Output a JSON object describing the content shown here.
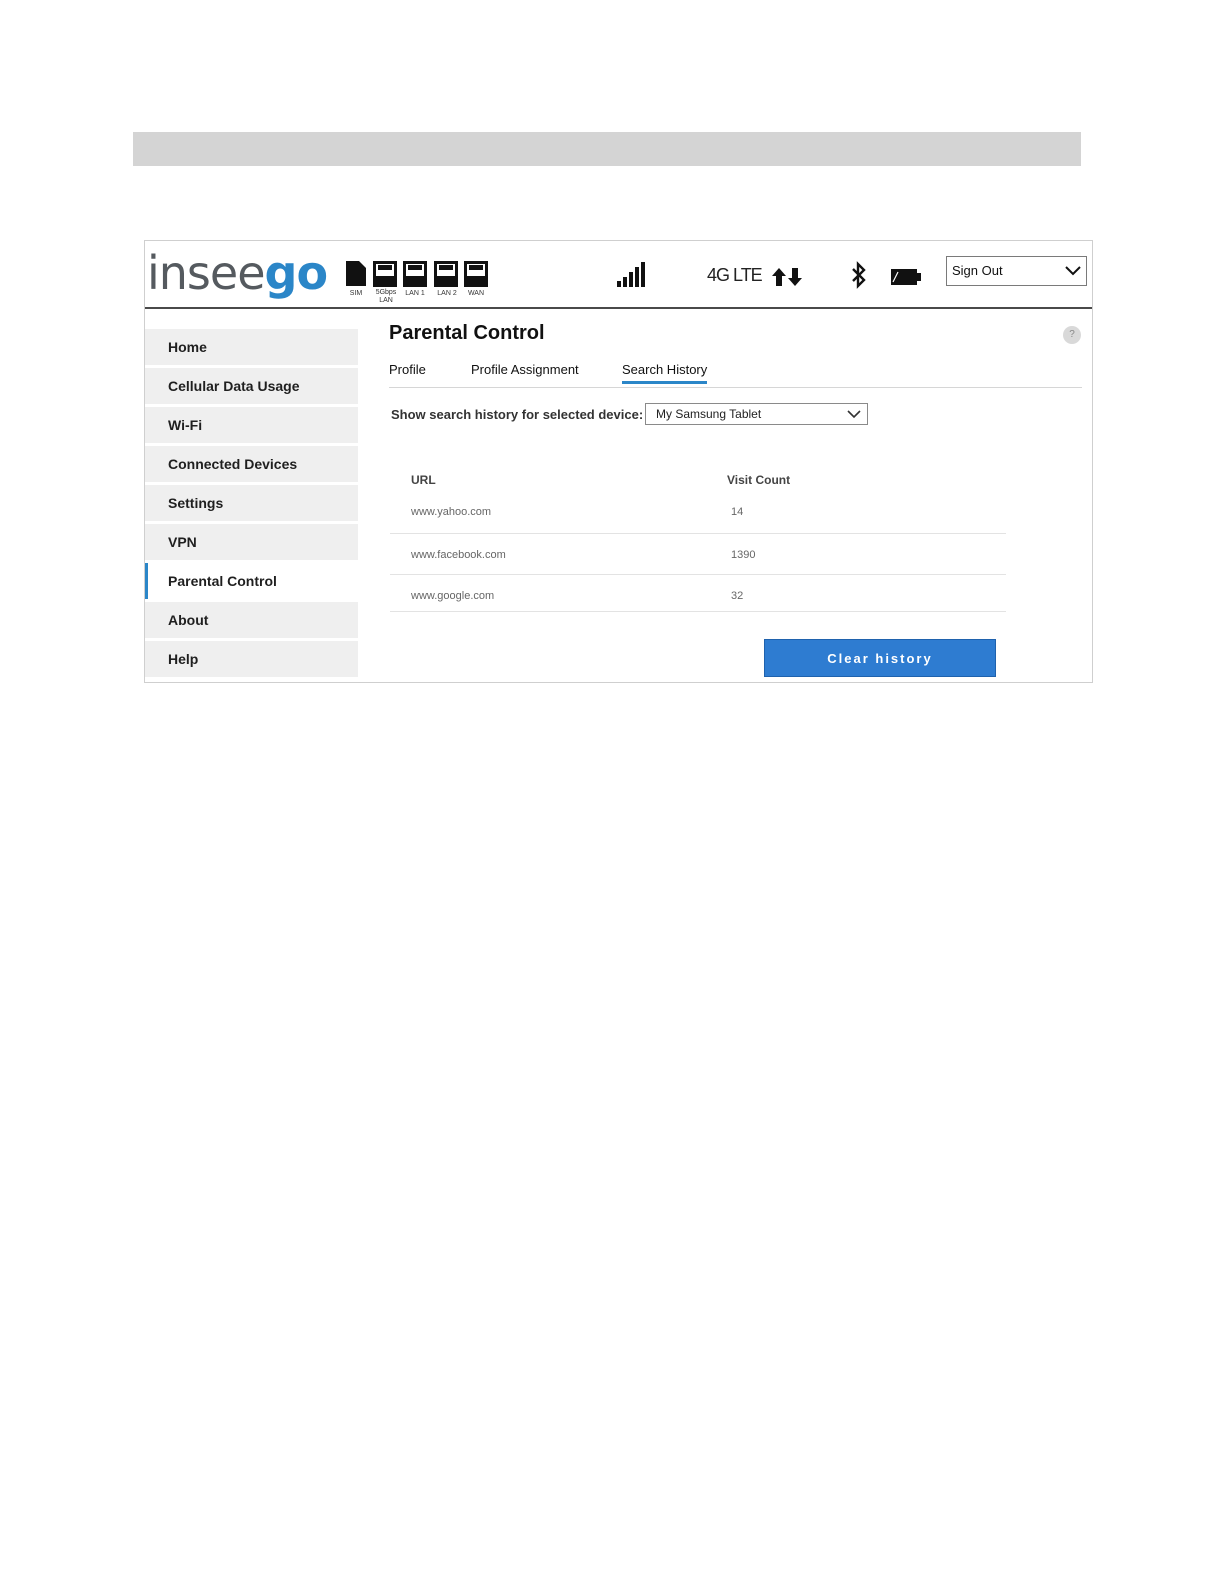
{
  "brand": {
    "logo_part1": "insee",
    "logo_part2": "go"
  },
  "header": {
    "ports": [
      {
        "label": "SIM"
      },
      {
        "label": "5Gbps LAN"
      },
      {
        "label": "LAN 1"
      },
      {
        "label": "LAN 2"
      },
      {
        "label": "WAN"
      }
    ],
    "network_type": "4G LTE",
    "icons": [
      "sim-card-icon",
      "ethernet-port-icon",
      "signal-bars-icon",
      "data-arrows-icon",
      "bluetooth-icon",
      "battery-icon"
    ],
    "signout_label": "Sign Out"
  },
  "sidebar": {
    "items": [
      {
        "label": "Home"
      },
      {
        "label": "Cellular Data Usage"
      },
      {
        "label": "Wi-Fi"
      },
      {
        "label": "Connected Devices"
      },
      {
        "label": "Settings"
      },
      {
        "label": "VPN"
      },
      {
        "label": "Parental Control",
        "active": true
      },
      {
        "label": "About"
      },
      {
        "label": "Help"
      }
    ]
  },
  "main": {
    "title": "Parental Control",
    "help_glyph": "?",
    "tabs": [
      {
        "label": "Profile"
      },
      {
        "label": "Profile Assignment"
      },
      {
        "label": "Search History",
        "active": true
      }
    ],
    "device_label": "Show search history for selected device:",
    "device_selected": "My Samsung Tablet",
    "table": {
      "headers": {
        "url": "URL",
        "count": "Visit Count"
      },
      "rows": [
        {
          "url": "www.yahoo.com",
          "count": "14"
        },
        {
          "url": "www.facebook.com",
          "count": "1390"
        },
        {
          "url": "www.google.com",
          "count": "32"
        }
      ]
    },
    "clear_label": "Clear history"
  },
  "colors": {
    "accent": "#2b86c8",
    "button": "#2e7cd1",
    "sidebar_bg": "#efefef",
    "banner": "#d4d4d4"
  }
}
